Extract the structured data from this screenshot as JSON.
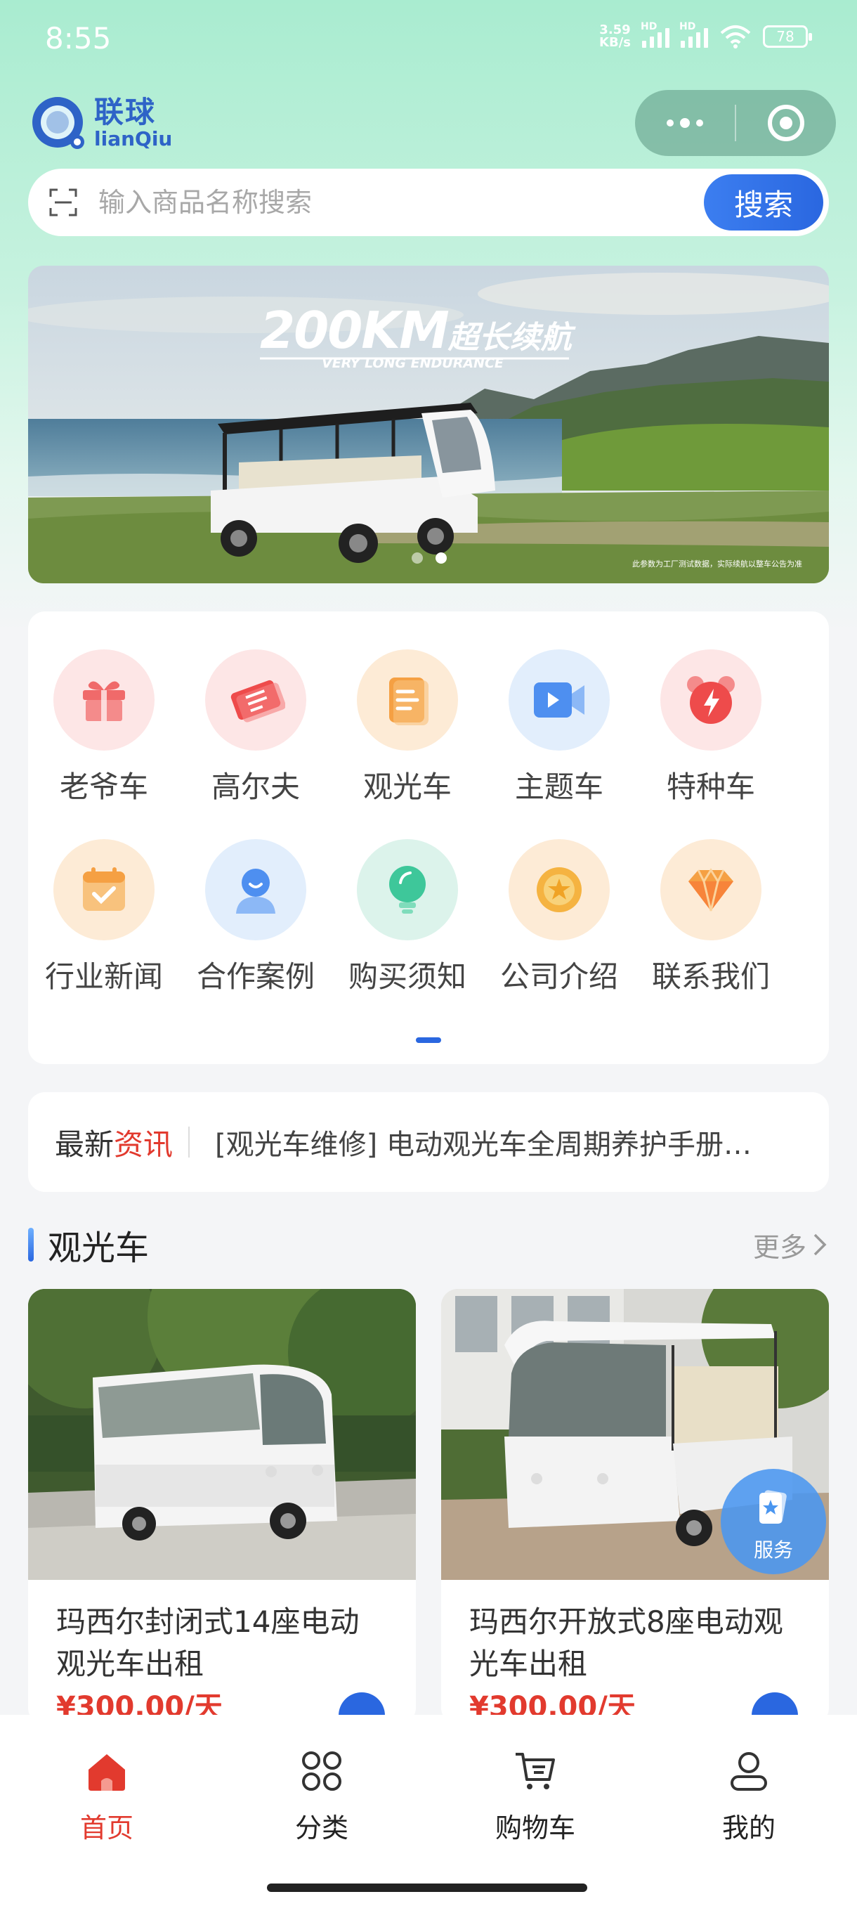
{
  "status_bar": {
    "time": "8:55",
    "net_speed_value": "3.59",
    "net_speed_unit": "KB/s",
    "sim1_label": "HD",
    "sim2_label": "HD",
    "battery": "78"
  },
  "header": {
    "logo_cn": "联球",
    "logo_en": "lianQiu"
  },
  "search": {
    "placeholder": "输入商品名称搜索",
    "button_label": "搜索"
  },
  "banner": {
    "headline_main": "200KM",
    "headline_cn": "超长续航",
    "headline_en": "VERY LONG ENDURANCE",
    "note": "此参数为工厂测试数据，实际续航以整车公告为准",
    "dots": 2,
    "active_dot": 1
  },
  "categories": [
    {
      "label": "老爷车",
      "icon": "gift-icon",
      "bg": "#fde6e6",
      "color": "#f06a6a"
    },
    {
      "label": "高尔夫",
      "icon": "ticket-icon",
      "bg": "#fde6e6",
      "color": "#ee4b4b"
    },
    {
      "label": "观光车",
      "icon": "document-icon",
      "bg": "#fdebd6",
      "color": "#f5a043"
    },
    {
      "label": "主题车",
      "icon": "video-icon",
      "bg": "#e2eefc",
      "color": "#4e8ff0"
    },
    {
      "label": "特种车",
      "icon": "alarm-clock-icon",
      "bg": "#fde6e6",
      "color": "#ee4b4b"
    },
    {
      "label": "行业新闻",
      "icon": "calendar-icon",
      "bg": "#fdebd6",
      "color": "#f5a043"
    },
    {
      "label": "合作案例",
      "icon": "user-icon",
      "bg": "#e2eefc",
      "color": "#4e8ff0"
    },
    {
      "label": "购买须知",
      "icon": "lightbulb-icon",
      "bg": "#dcf3eb",
      "color": "#3ec79a"
    },
    {
      "label": "公司介绍",
      "icon": "medal-icon",
      "bg": "#fdebd6",
      "color": "#f5b341"
    },
    {
      "label": "联系我们",
      "icon": "diamond-icon",
      "bg": "#fdebd6",
      "color": "#f5a043"
    }
  ],
  "news": {
    "title_prefix": "最新",
    "title_highlight": "资讯",
    "item": "[观光车维修] 电动观光车全周期养护手册…"
  },
  "section": {
    "title": "观光车",
    "more_label": "更多"
  },
  "products": [
    {
      "name": "玛西尔封闭式14座电动观光车出租",
      "price": "¥300.00/天"
    },
    {
      "name": "玛西尔开放式8座电动观光车出租",
      "price": "¥300.00/天"
    }
  ],
  "service": {
    "label": "服务"
  },
  "tabbar": [
    {
      "label": "首页",
      "icon": "home-icon",
      "active": true
    },
    {
      "label": "分类",
      "icon": "grid-icon",
      "active": false
    },
    {
      "label": "购物车",
      "icon": "cart-icon",
      "active": false
    },
    {
      "label": "我的",
      "icon": "profile-icon",
      "active": false
    }
  ],
  "colors": {
    "accent_blue": "#2a67e0",
    "accent_red": "#e23a2e",
    "header_green": "#a9ecd0"
  }
}
